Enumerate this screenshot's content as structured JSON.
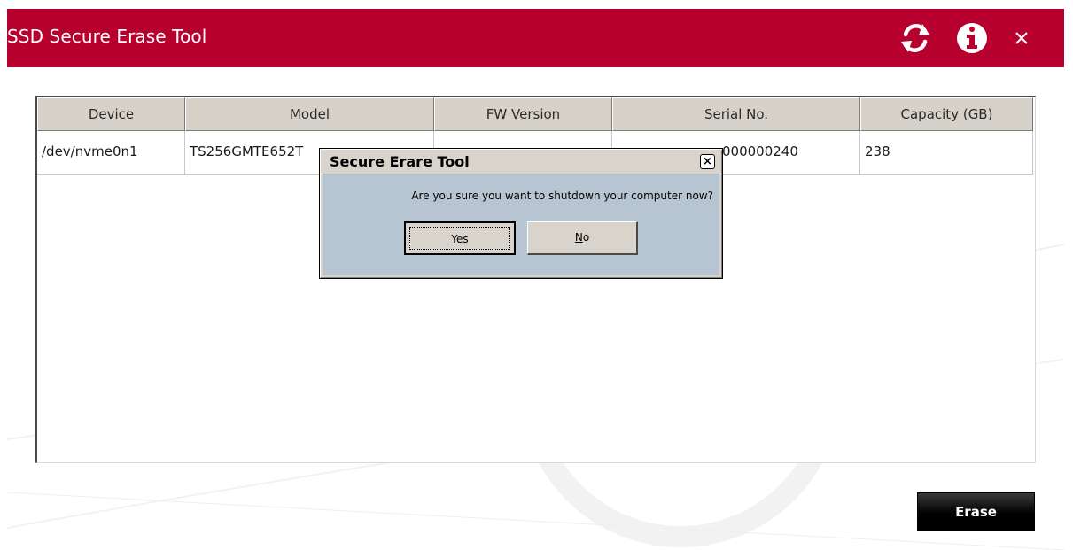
{
  "window": {
    "title": "SSD Secure Erase Tool",
    "icons": [
      "refresh-icon",
      "info-icon",
      "close-icon"
    ],
    "colors": {
      "titlebar": "#b8002e",
      "erase_button": "#000000"
    }
  },
  "table": {
    "columns": [
      "Device",
      "Model",
      "FW Version",
      "Serial No.",
      "Capacity (GB)"
    ],
    "rows": [
      {
        "device": "/dev/nvme0n1",
        "model": "TS256GMTE652T",
        "fw_version": "",
        "serial_no": "000000240",
        "capacity": "238"
      }
    ]
  },
  "actions": {
    "erase_label": "Erase"
  },
  "dialog": {
    "title": "Secure Erare Tool",
    "message": "Are you sure you want to shutdown your computer now?",
    "yes_mnemonic": "Y",
    "yes_rest": "es",
    "no_mnemonic": "N",
    "no_rest": "o"
  }
}
